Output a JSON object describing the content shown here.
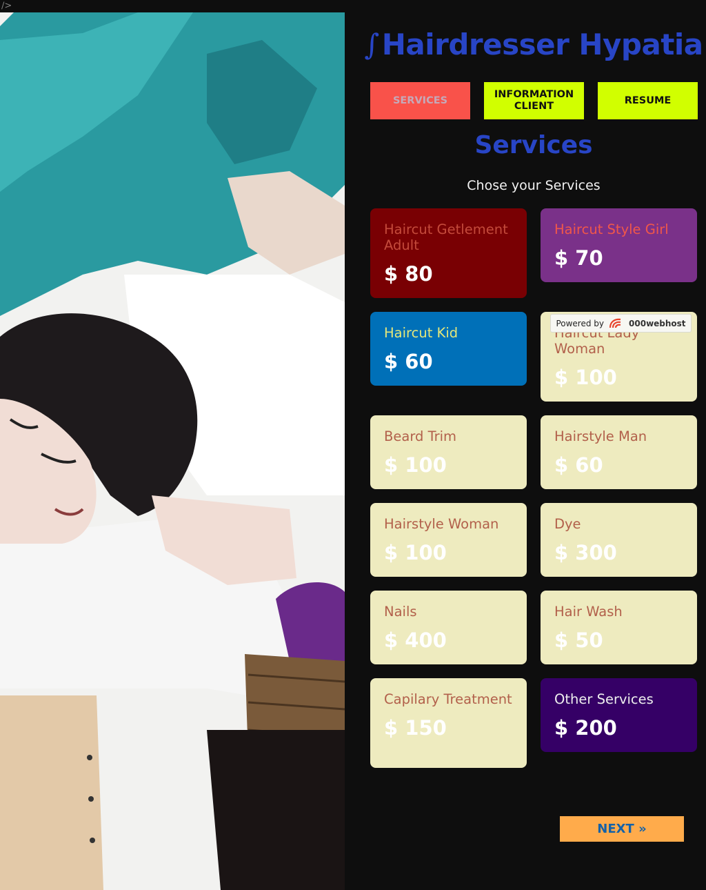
{
  "stray_markup": "/>",
  "brand": {
    "logo_glyph": "∫",
    "title": "Hairdresser Hypatia"
  },
  "nav": [
    {
      "label": "SERVICES"
    },
    {
      "label": "INFORMATION CLIENT"
    },
    {
      "label": "RESUME"
    }
  ],
  "section": {
    "title": "Services",
    "subtitle": "Chose your Services"
  },
  "services": [
    {
      "name": "Haircut Getlement Adult",
      "price": "$ 80",
      "color": "#790003"
    },
    {
      "name": "Haircut Style Girl",
      "price": "$ 70",
      "color": "#7a3189"
    },
    {
      "name": "Haircut Kid",
      "price": "$ 60",
      "color": "#0070b8"
    },
    {
      "name": "Haircut Lady Woman",
      "price": "$ 100",
      "color": "#eeebbf"
    },
    {
      "name": "Beard Trim",
      "price": "$ 100",
      "color": "#eeebbf"
    },
    {
      "name": "Hairstyle Man",
      "price": "$ 60",
      "color": "#eeebbf"
    },
    {
      "name": "Hairstyle Woman",
      "price": "$ 100",
      "color": "#eeebbf"
    },
    {
      "name": "Dye",
      "price": "$ 300",
      "color": "#eeebbf"
    },
    {
      "name": "Nails",
      "price": "$ 400",
      "color": "#eeebbf"
    },
    {
      "name": "Hair Wash",
      "price": "$ 50",
      "color": "#eeebbf"
    },
    {
      "name": "Capilary Treatment",
      "price": "$ 150",
      "color": "#eeebbf"
    },
    {
      "name": "Other Services",
      "price": "$ 200",
      "color": "#350066"
    }
  ],
  "next_label": "NEXT »",
  "powered_by": {
    "prefix": "Powered by",
    "host": "000webhost"
  },
  "colors": {
    "accent_blue": "#2845c6",
    "lime": "#d1ff00",
    "coral": "#f9524a",
    "orange": "#ffab4b",
    "background": "#0e0e0e"
  }
}
